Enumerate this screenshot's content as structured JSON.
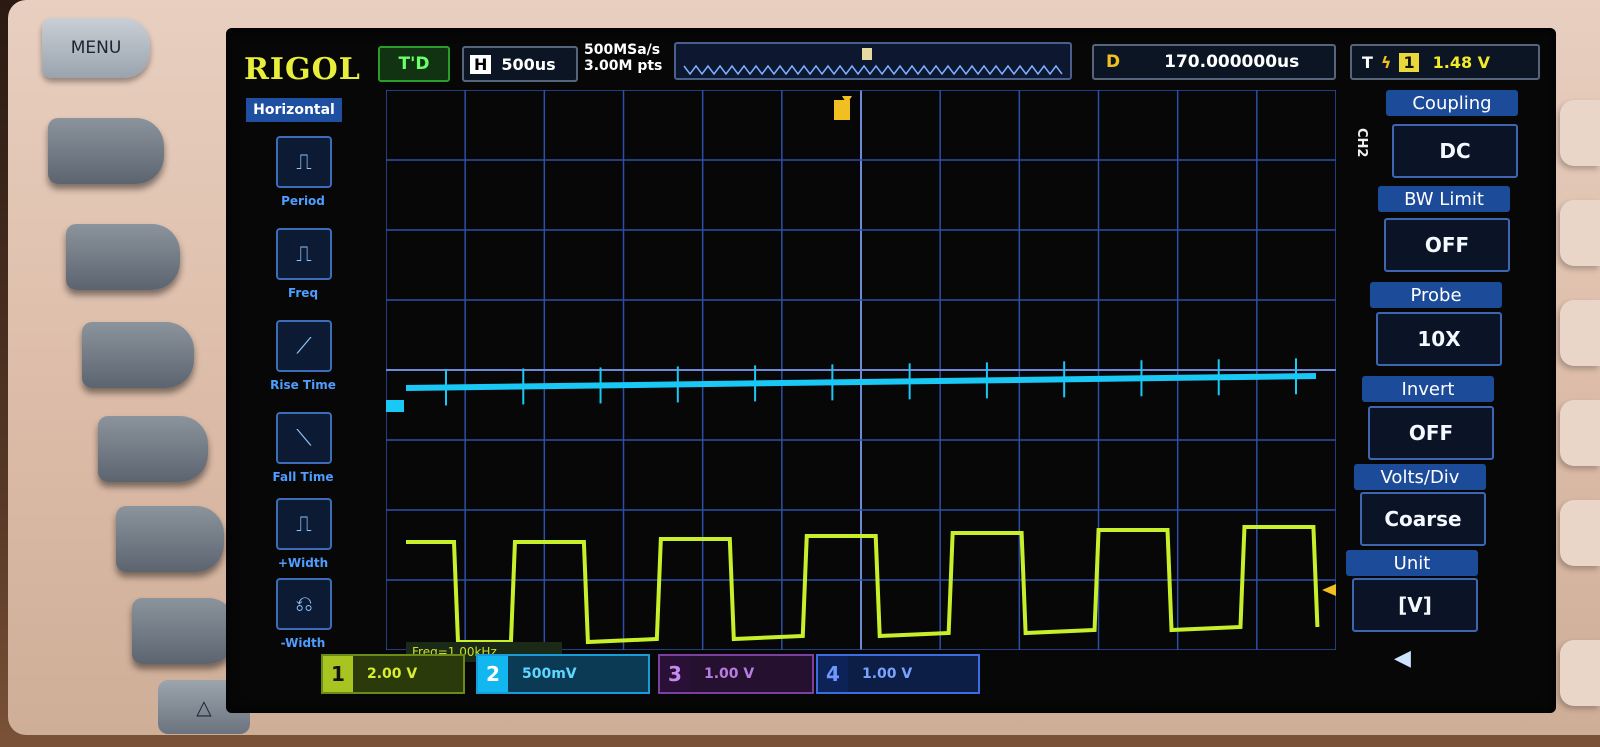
{
  "device": {
    "brand": "RIGOL",
    "menu_label": "MENU",
    "up_arrow": "△"
  },
  "topbar": {
    "run_status": "T'D",
    "timebase_tag": "H",
    "timebase": "500us",
    "sample_rate": "500MSa/s",
    "mem_depth": "3.00M pts",
    "delay_tag": "D",
    "delay": "170.000000us",
    "trigger_tag": "T",
    "trigger_edge_icon": "rising-edge-icon",
    "trigger_source": "1",
    "trigger_level": "1.48 V"
  },
  "left_menu": {
    "title": "Horizontal",
    "items": [
      {
        "label": "Period",
        "icon": "pulse-train-icon",
        "glyph": "⎍"
      },
      {
        "label": "Freq",
        "icon": "frequency-icon",
        "glyph": "⎍"
      },
      {
        "label": "Rise Time",
        "icon": "rise-edge-icon",
        "glyph": "⟋"
      },
      {
        "label": "Fall Time",
        "icon": "fall-edge-icon",
        "glyph": "⟍"
      },
      {
        "label": "+Width",
        "icon": "positive-width-icon",
        "glyph": "⎍"
      },
      {
        "label": "-Width",
        "icon": "negative-width-icon",
        "glyph": "⎌"
      }
    ]
  },
  "right_menu": {
    "channel_tag": "CH2",
    "items": [
      {
        "header": "Coupling",
        "value": "DC"
      },
      {
        "header": "BW Limit",
        "value": "OFF"
      },
      {
        "header": "Probe",
        "value": "10X"
      },
      {
        "header": "Invert",
        "value": "OFF"
      },
      {
        "header": "Volts/Div",
        "value": "Coarse"
      },
      {
        "header": "Unit",
        "value": "[V]"
      }
    ]
  },
  "measurement": {
    "freq_label": "Freq=1.00kHz"
  },
  "channels": [
    {
      "num": "1",
      "scale": "2.00 V"
    },
    {
      "num": "2",
      "scale": "500mV"
    },
    {
      "num": "3",
      "scale": "1.00 V"
    },
    {
      "num": "4",
      "scale": "1.00 V"
    }
  ],
  "waveforms": {
    "ch1_color": "#c8f02a",
    "ch2_color": "#19c8f5",
    "grid_color": "#2e4fa8",
    "ch1_square_wave_periods_visible": 6,
    "ch2_spike_count": 12
  },
  "icons": {
    "speaker": "speaker-icon"
  }
}
